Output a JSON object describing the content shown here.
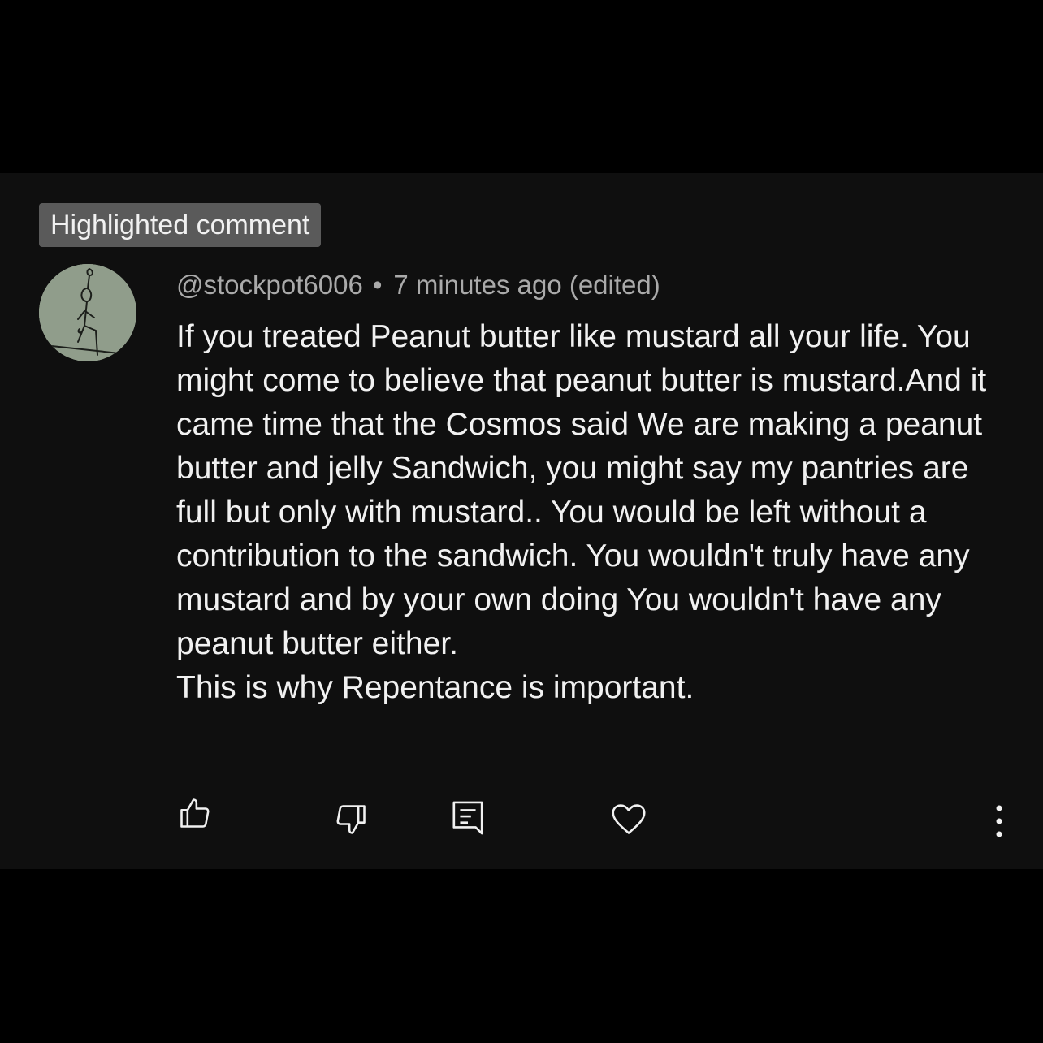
{
  "comment": {
    "badge": "Highlighted comment",
    "username": "@stockpot6006",
    "separator": "•",
    "timestamp": "7 minutes ago (edited)",
    "paragraphs": [
      "If you treated Peanut butter like mustard all your life. You might come to believe that peanut butter is mustard.And it came time that the Cosmos said We are making a peanut butter and jelly Sandwich, you might say my pantries are full but only with mustard.. You would be left without a contribution to the sandwich. You wouldn't truly have any mustard and by your own doing You wouldn't have any peanut butter either.",
      "This is why Repentance is important."
    ]
  },
  "actions": {
    "like": "thumbs-up-icon",
    "dislike": "thumbs-down-icon",
    "reply": "reply-icon",
    "heart": "heart-icon",
    "more": "more-vertical-icon"
  },
  "colors": {
    "page_background": "#000000",
    "card_background": "#0f0f0f",
    "badge_background": "#5a5a5a",
    "text_primary": "#f1f1f1",
    "text_secondary": "#aaaaaa",
    "avatar_background": "#8f9c8a"
  }
}
